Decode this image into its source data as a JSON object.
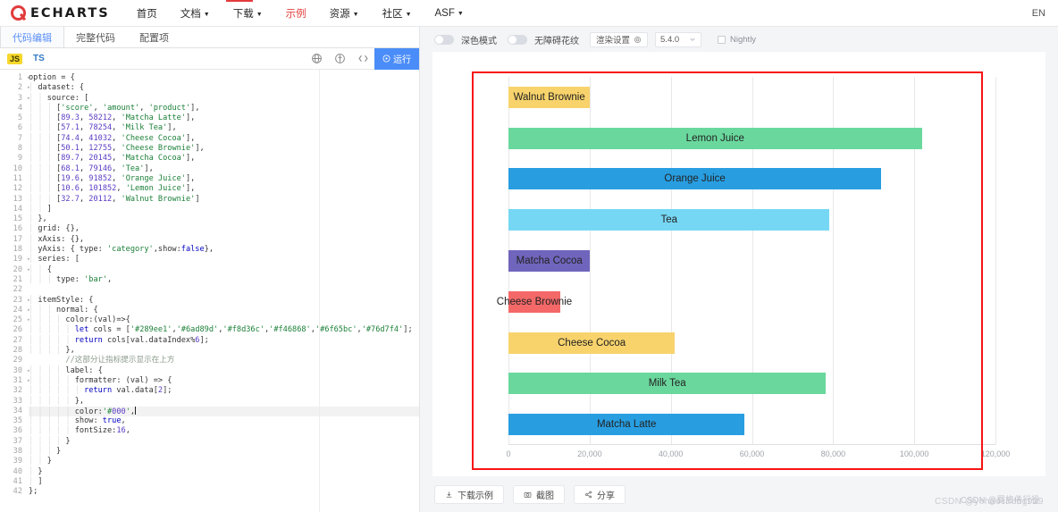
{
  "topnav": {
    "brand": "ECHARTS",
    "links": [
      {
        "label": "首页",
        "caret": false,
        "active": false
      },
      {
        "label": "文档",
        "caret": true,
        "active": false
      },
      {
        "label": "下载",
        "caret": true,
        "active": false
      },
      {
        "label": "示例",
        "caret": false,
        "active": true
      },
      {
        "label": "资源",
        "caret": true,
        "active": false
      },
      {
        "label": "社区",
        "caret": true,
        "active": false
      },
      {
        "label": "ASF",
        "caret": true,
        "active": false
      }
    ],
    "lang": "EN"
  },
  "editor": {
    "tabs": [
      {
        "label": "代码编辑",
        "active": true
      },
      {
        "label": "完整代码",
        "active": false
      },
      {
        "label": "配置项",
        "active": false
      }
    ],
    "lang_js": "JS",
    "lang_ts": "TS",
    "icons": [
      "globe-icon",
      "umbrella-icon",
      "code-brackets-icon"
    ],
    "run_label": "运行",
    "run_icon": "play-circle-icon",
    "active_line": 34,
    "total_lines": 42,
    "code_lines": [
      {
        "n": 1,
        "fold": true,
        "html": "option = {"
      },
      {
        "n": 2,
        "fold": true,
        "html": "  dataset: {"
      },
      {
        "n": 3,
        "fold": true,
        "html": "    source: ["
      },
      {
        "n": 4,
        "fold": false,
        "html": "      ['score', 'amount', 'product'],"
      },
      {
        "n": 5,
        "fold": false,
        "html": "      [89.3, 58212, 'Matcha Latte'],"
      },
      {
        "n": 6,
        "fold": false,
        "html": "      [57.1, 78254, 'Milk Tea'],"
      },
      {
        "n": 7,
        "fold": false,
        "html": "      [74.4, 41032, 'Cheese Cocoa'],"
      },
      {
        "n": 8,
        "fold": false,
        "html": "      [50.1, 12755, 'Cheese Brownie'],"
      },
      {
        "n": 9,
        "fold": false,
        "html": "      [89.7, 20145, 'Matcha Cocoa'],"
      },
      {
        "n": 10,
        "fold": false,
        "html": "      [68.1, 79146, 'Tea'],"
      },
      {
        "n": 11,
        "fold": false,
        "html": "      [19.6, 91852, 'Orange Juice'],"
      },
      {
        "n": 12,
        "fold": false,
        "html": "      [10.6, 101852, 'Lemon Juice'],"
      },
      {
        "n": 13,
        "fold": false,
        "html": "      [32.7, 20112, 'Walnut Brownie']"
      },
      {
        "n": 14,
        "fold": false,
        "html": "    ]"
      },
      {
        "n": 15,
        "fold": false,
        "html": "  },"
      },
      {
        "n": 16,
        "fold": false,
        "html": "  grid: {},"
      },
      {
        "n": 17,
        "fold": false,
        "html": "  xAxis: {},"
      },
      {
        "n": 18,
        "fold": false,
        "html": "  yAxis: { type: 'category',show:false},"
      },
      {
        "n": 19,
        "fold": true,
        "html": "  series: ["
      },
      {
        "n": 20,
        "fold": true,
        "html": "    {"
      },
      {
        "n": 21,
        "fold": false,
        "html": "      type: 'bar',"
      },
      {
        "n": 22,
        "fold": false,
        "html": ""
      },
      {
        "n": 23,
        "fold": true,
        "html": "  itemStyle: {"
      },
      {
        "n": 24,
        "fold": true,
        "html": "      normal: {"
      },
      {
        "n": 25,
        "fold": true,
        "html": "        color:(val)=>{"
      },
      {
        "n": 26,
        "fold": false,
        "html": "          let cols = ['#289ee1','#6ad89d','#f8d36c','#f46868','#6f65bc','#76d7f4'];"
      },
      {
        "n": 27,
        "fold": false,
        "html": "          return cols[val.dataIndex%6];"
      },
      {
        "n": 28,
        "fold": false,
        "html": "        },"
      },
      {
        "n": 29,
        "fold": false,
        "html": "        //这部分让指标提示显示在上方"
      },
      {
        "n": 30,
        "fold": true,
        "html": "        label: {"
      },
      {
        "n": 31,
        "fold": true,
        "html": "          formatter: (val) => {"
      },
      {
        "n": 32,
        "fold": false,
        "html": "            return val.data[2];"
      },
      {
        "n": 33,
        "fold": false,
        "html": "          },"
      },
      {
        "n": 34,
        "fold": false,
        "html": "          color:'#000',"
      },
      {
        "n": 35,
        "fold": false,
        "html": "          show: true,"
      },
      {
        "n": 36,
        "fold": false,
        "html": "          fontSize:16,"
      },
      {
        "n": 37,
        "fold": false,
        "html": "        }"
      },
      {
        "n": 38,
        "fold": false,
        "html": "      }"
      },
      {
        "n": 39,
        "fold": false,
        "html": "    }"
      },
      {
        "n": 40,
        "fold": false,
        "html": "  }"
      },
      {
        "n": 41,
        "fold": false,
        "html": "  ]"
      },
      {
        "n": 42,
        "fold": false,
        "html": "};"
      }
    ]
  },
  "chart_toolbar": {
    "dark_mode_label": "深色模式",
    "dark_mode_on": false,
    "pattern_label": "无障碍花纹",
    "pattern_on": false,
    "render_settings_label": "渲染设置",
    "render_settings_icon": "gear-icon",
    "version": "5.4.0",
    "nightly_label": "Nightly",
    "nightly_checked": false
  },
  "bottom_buttons": [
    {
      "label": "下载示例",
      "icon": "download-icon"
    },
    {
      "label": "截图",
      "icon": "camera-icon"
    },
    {
      "label": "分享",
      "icon": "share-icon"
    }
  ],
  "watermark": {
    "line1": "CSDN @yehaocheng929",
    "line2": "CSDN @羁旅倦行役"
  },
  "colors": {
    "accent_red": "#e43c3c",
    "run_blue": "#4b8df8",
    "annotation_red": "#f81414",
    "palette": [
      "#289ee1",
      "#6ad89d",
      "#f8d36c",
      "#f46868",
      "#6f65bc",
      "#76d7f4"
    ]
  },
  "chart_data": {
    "type": "bar",
    "orientation": "horizontal",
    "title": "",
    "xlabel": "",
    "ylabel": "",
    "xlim": [
      0,
      120000
    ],
    "xticks": [
      0,
      20000,
      40000,
      60000,
      80000,
      100000,
      120000
    ],
    "xtick_labels": [
      "0",
      "20,000",
      "40,000",
      "60,000",
      "80,000",
      "100,000",
      "120,000"
    ],
    "grid": true,
    "legend": "none",
    "yaxis_visible": false,
    "label_position": "inside",
    "label_font_size": 16,
    "label_color": "#000",
    "categories": [
      "Matcha Latte",
      "Milk Tea",
      "Cheese Cocoa",
      "Cheese Brownie",
      "Matcha Cocoa",
      "Tea",
      "Orange Juice",
      "Lemon Juice",
      "Walnut Brownie"
    ],
    "values": [
      58212,
      78254,
      41032,
      12755,
      20145,
      79146,
      91852,
      101852,
      20112
    ],
    "scores": [
      89.3,
      57.1,
      74.4,
      50.1,
      89.7,
      68.1,
      19.6,
      10.6,
      32.7
    ],
    "bar_colors": [
      "#289ee1",
      "#6ad89d",
      "#f8d36c",
      "#f46868",
      "#6f65bc",
      "#76d7f4",
      "#289ee1",
      "#6ad89d",
      "#f8d36c"
    ],
    "bars_top_to_bottom": [
      {
        "label": "Walnut Brownie",
        "value": 20112,
        "color": "#f8d36c"
      },
      {
        "label": "Lemon Juice",
        "value": 101852,
        "color": "#6ad89d"
      },
      {
        "label": "Orange Juice",
        "value": 91852,
        "color": "#289ee1"
      },
      {
        "label": "Tea",
        "value": 79146,
        "color": "#76d7f4"
      },
      {
        "label": "Matcha Cocoa",
        "value": 20145,
        "color": "#6f65bc"
      },
      {
        "label": "Cheese Brownie",
        "value": 12755,
        "color": "#f46868"
      },
      {
        "label": "Cheese Cocoa",
        "value": 41032,
        "color": "#f8d36c"
      },
      {
        "label": "Milk Tea",
        "value": 78254,
        "color": "#6ad89d"
      },
      {
        "label": "Matcha Latte",
        "value": 58212,
        "color": "#289ee1"
      }
    ]
  }
}
